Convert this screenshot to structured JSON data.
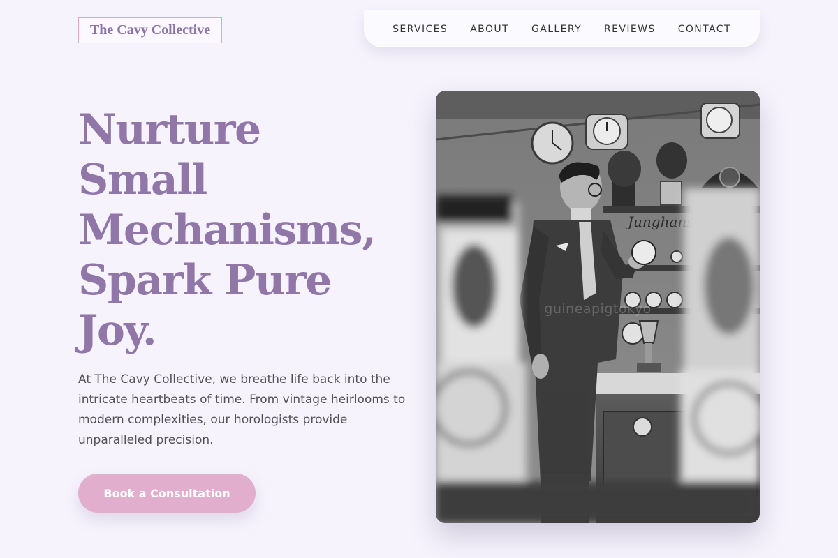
{
  "brand": {
    "logo_text": "The Cavy Collective"
  },
  "nav": {
    "items": [
      "SERVICES",
      "ABOUT",
      "GALLERY",
      "REVIEWS",
      "CONTACT"
    ]
  },
  "hero": {
    "title_lines": [
      "Nurture",
      "Small",
      "Mechanisms,",
      "Spark Pure",
      "Joy."
    ],
    "description": "At The Cavy Collective, we breathe life back into the intricate heartbeats of time. From vintage heirlooms to modern complexities, our horologists provide unparalleled precision.",
    "cta_label": "Book a Consultation"
  },
  "photo": {
    "watermark": "guineapigtokyo",
    "sign_text": "Junghans"
  },
  "colors": {
    "background": "#f6f3fd",
    "accent_purple": "#9077a8",
    "cta_pink": "#e2aecd",
    "logo_border": "#e0a8c8"
  }
}
